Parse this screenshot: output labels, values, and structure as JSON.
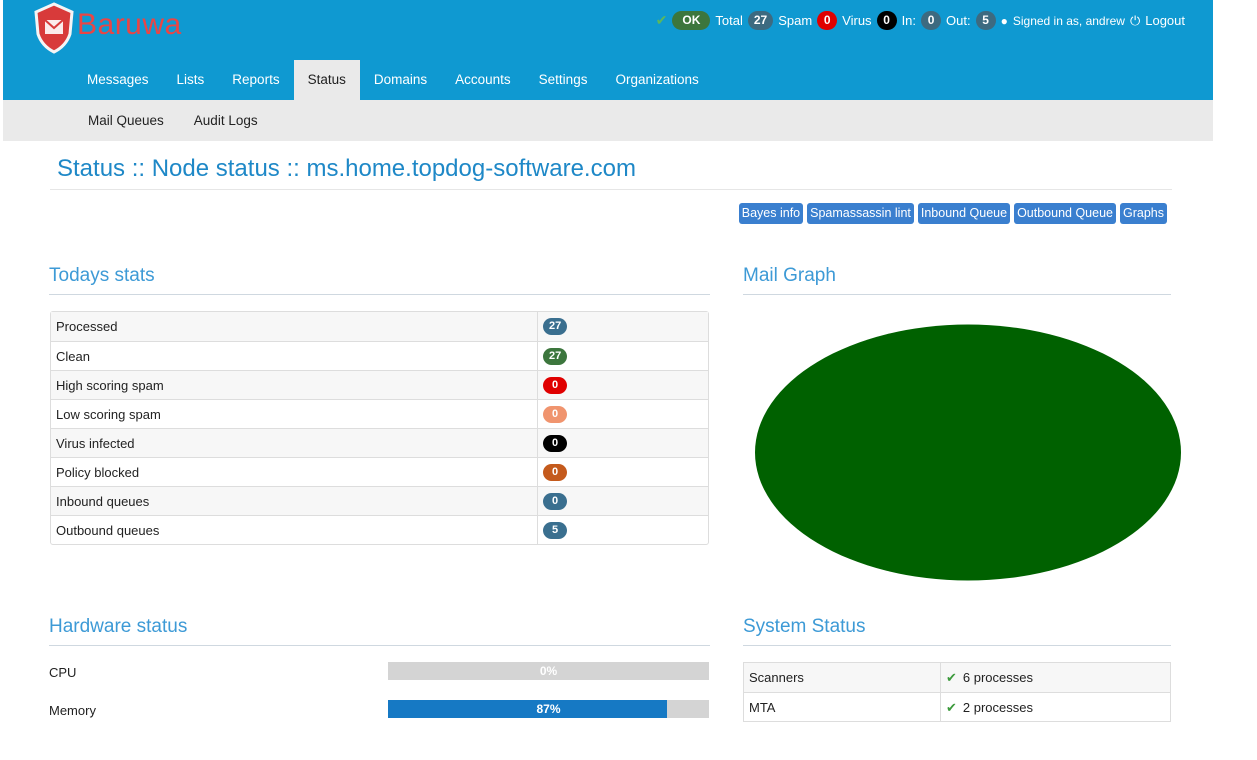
{
  "header": {
    "logo_text": "Baruwa",
    "status": {
      "ok_label": "OK",
      "total_label": "Total",
      "total_value": "27",
      "spam_label": "Spam",
      "spam_value": "0",
      "virus_label": "Virus",
      "virus_value": "0",
      "in_label": "In:",
      "in_value": "0",
      "out_label": "Out:",
      "out_value": "5",
      "signed_in": "Signed in as, andrew",
      "logout": "Logout"
    },
    "nav": [
      "Messages",
      "Lists",
      "Reports",
      "Status",
      "Domains",
      "Accounts",
      "Settings",
      "Organizations"
    ],
    "active_nav": "Status",
    "subnav": [
      "Mail Queues",
      "Audit Logs"
    ]
  },
  "page": {
    "title": "Status :: Node status :: ms.home.topdog-software.com",
    "actions": [
      "Bayes info",
      "Spamassassin lint",
      "Inbound Queue",
      "Outbound Queue",
      "Graphs"
    ]
  },
  "todays_stats": {
    "heading": "Todays stats",
    "rows": [
      {
        "label": "Processed",
        "value": "27",
        "color": "#3a6f8f"
      },
      {
        "label": "Clean",
        "value": "27",
        "color": "#3c763d"
      },
      {
        "label": "High scoring spam",
        "value": "0",
        "color": "#e00000"
      },
      {
        "label": "Low scoring spam",
        "value": "0",
        "color": "#f0946e"
      },
      {
        "label": "Virus infected",
        "value": "0",
        "color": "#000000"
      },
      {
        "label": "Policy blocked",
        "value": "0",
        "color": "#c45a1c"
      },
      {
        "label": "Inbound queues",
        "value": "0",
        "color": "#3a6f8f"
      },
      {
        "label": "Outbound queues",
        "value": "5",
        "color": "#3a6f8f"
      }
    ]
  },
  "mail_graph": {
    "heading": "Mail Graph",
    "color": "#006100",
    "clean_fraction": 1.0
  },
  "hardware": {
    "heading": "Hardware status",
    "items": [
      {
        "label": "CPU",
        "percent": 0,
        "text": "0%"
      },
      {
        "label": "Memory",
        "percent": 87,
        "text": "87%"
      }
    ]
  },
  "system_status": {
    "heading": "System Status",
    "rows": [
      {
        "label": "Scanners",
        "value": "6 processes"
      },
      {
        "label": "MTA",
        "value": "2 processes"
      }
    ]
  }
}
